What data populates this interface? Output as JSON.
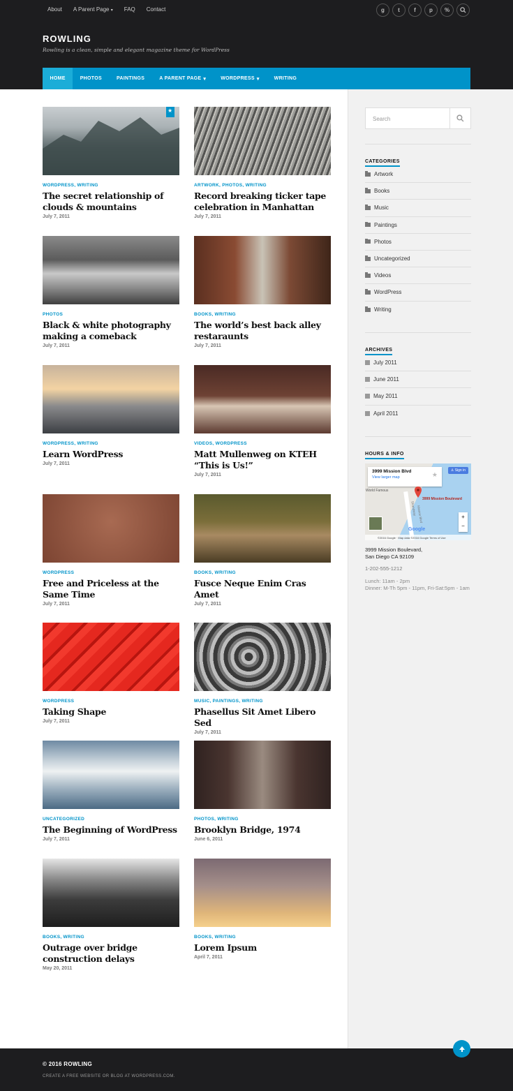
{
  "top_menu": [
    "About",
    "A Parent Page",
    "FAQ",
    "Contact"
  ],
  "social_icons": [
    "google-plus-icon",
    "twitter-icon",
    "facebook-icon",
    "pinterest-icon",
    "link-icon",
    "search-icon"
  ],
  "site": {
    "name": "ROWLING",
    "tagline": "Rowling is a clean, simple and elegant magazine theme for WordPress"
  },
  "nav": [
    "HOME",
    "PHOTOS",
    "PAINTINGS",
    "A PARENT PAGE",
    "WORDPRESS",
    "WRITING"
  ],
  "search": {
    "placeholder": "Search"
  },
  "categories": {
    "title": "CATEGORIES",
    "items": [
      "Artwork",
      "Books",
      "Music",
      "Paintings",
      "Photos",
      "Uncategorized",
      "Videos",
      "WordPress",
      "Writing"
    ]
  },
  "archives": {
    "title": "ARCHIVES",
    "items": [
      "July 2011",
      "June 2011",
      "May 2011",
      "April 2011"
    ]
  },
  "hours": {
    "title": "HOURS & INFO",
    "map_place": "3999 Mission Blvd",
    "map_link": "View larger map",
    "map_sign_in": "Sign in",
    "map_pin_label": "3999 Mission Boulevard",
    "map_area": "World Famous",
    "map_road": "Strandway",
    "map_road2": "Mission Blvd",
    "map_footer": "©2016 Google · Map data ©2016 Google  Terms of Use",
    "map_brand": "Google",
    "address1": "3999 Mission Boulevard,",
    "address2": "San Diego CA 92109",
    "phone": "1-202-555-1212",
    "lunch": "Lunch: 11am - 2pm",
    "dinner": "Dinner: M-Th 5pm - 11pm, Fri-Sat:5pm - 1am"
  },
  "posts": [
    {
      "cat": "WORDPRESS, WRITING",
      "title": "The secret relationship of clouds & mountains",
      "date": "July 7, 2011"
    },
    {
      "cat": "ARTWORK, PHOTOS, WRITING",
      "title": "Record breaking ticker tape celebration in Manhattan",
      "date": "July 7, 2011"
    },
    {
      "cat": "PHOTOS",
      "title": "Black & white photography making a comeback",
      "date": "July 7, 2011"
    },
    {
      "cat": "BOOKS, WRITING",
      "title": "The world’s best back alley restaraunts",
      "date": "July 7, 2011"
    },
    {
      "cat": "WORDPRESS, WRITING",
      "title": "Learn WordPress",
      "date": "July 7, 2011"
    },
    {
      "cat": "VIDEOS, WORDPRESS",
      "title": "Matt Mullenweg on KTEH “This is Us!”",
      "date": "July 7, 2011"
    },
    {
      "cat": "WORDPRESS",
      "title": "Free and Priceless at the Same Time",
      "date": "July 7, 2011"
    },
    {
      "cat": "BOOKS, WRITING",
      "title": "Fusce Neque Enim Cras Amet",
      "date": "July 7, 2011"
    },
    {
      "cat": "WORDPRESS",
      "title": "Taking Shape",
      "date": "July 7, 2011"
    },
    {
      "cat": "MUSIC, PAINTINGS, WRITING",
      "title": "Phasellus Sit Amet Libero Sed",
      "date": "July 7, 2011"
    },
    {
      "cat": "UNCATEGORIZED",
      "title": "The Beginning of WordPress",
      "date": "July 7, 2011"
    },
    {
      "cat": "PHOTOS, WRITING",
      "title": "Brooklyn Bridge, 1974",
      "date": "June 6, 2011"
    },
    {
      "cat": "BOOKS, WRITING",
      "title": "Outrage over bridge construction delays",
      "date": "May 20, 2011"
    },
    {
      "cat": "BOOKS, WRITING",
      "title": "Lorem Ipsum",
      "date": "April 7, 2011"
    }
  ],
  "footer": {
    "copyright": "© 2016 ROWLING",
    "credit": "CREATE A FREE WEBSITE OR BLOG AT WORDPRESS.COM."
  },
  "colors": {
    "accent": "#0093c9",
    "header_bg": "#1d1d1f"
  }
}
